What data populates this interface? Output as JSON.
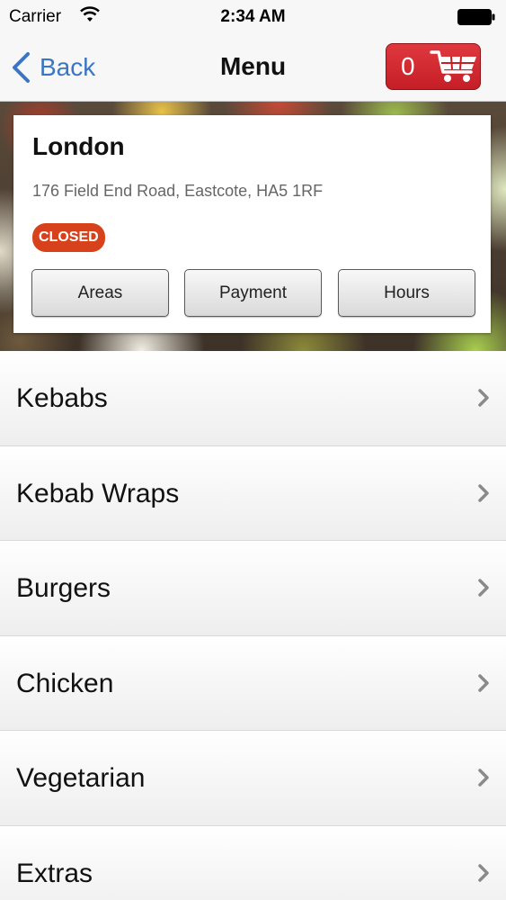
{
  "status_bar": {
    "carrier": "Carrier",
    "time": "2:34 AM"
  },
  "nav": {
    "back_label": "Back",
    "title": "Menu",
    "cart_count": "0",
    "accent_color": "#3a76c4",
    "cart_color": "#d2232a"
  },
  "location": {
    "name": "London",
    "address": "176 Field End Road, Eastcote, HA5 1RF",
    "status": "CLOSED",
    "status_color": "#d7421c",
    "buttons": [
      "Areas",
      "Payment",
      "Hours"
    ]
  },
  "menu": {
    "items": [
      "Kebabs",
      "Kebab Wraps",
      "Burgers",
      "Chicken",
      "Vegetarian",
      "Extras"
    ]
  }
}
